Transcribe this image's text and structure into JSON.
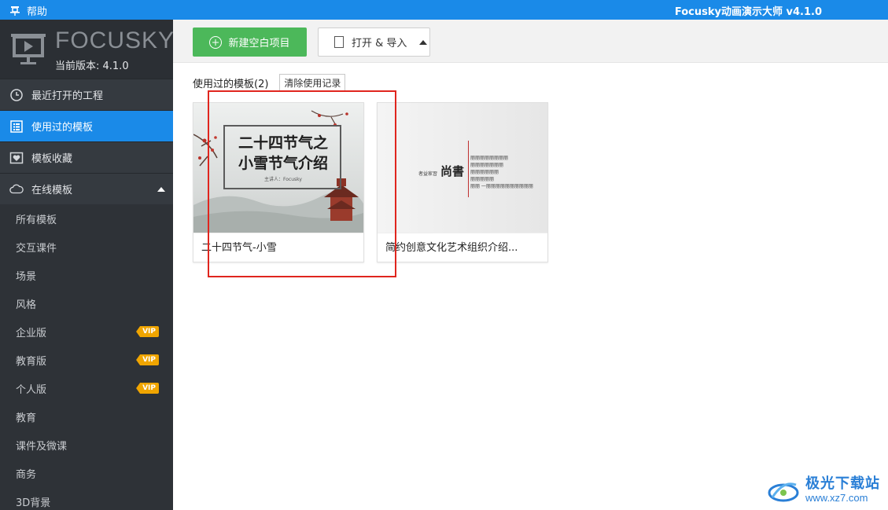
{
  "window": {
    "help_label": "帮助",
    "title": "Focusky动画演示大师 v4.1.0"
  },
  "brand": {
    "name": "FOCUSKY",
    "version": "当前版本: 4.1.0"
  },
  "nav": {
    "items": [
      {
        "label": "最近打开的工程",
        "icon": "clock-icon",
        "active": false
      },
      {
        "label": "使用过的模板",
        "icon": "list-icon",
        "active": true
      },
      {
        "label": "模板收藏",
        "icon": "heart-icon",
        "active": false
      },
      {
        "label": "在线模板",
        "icon": "cloud-icon",
        "active": false
      }
    ],
    "sub_items": [
      {
        "label": "所有模板",
        "badge": ""
      },
      {
        "label": "交互课件",
        "badge": ""
      },
      {
        "label": "场景",
        "badge": ""
      },
      {
        "label": "风格",
        "badge": ""
      },
      {
        "label": "企业版",
        "badge": "VIP"
      },
      {
        "label": "教育版",
        "badge": "VIP"
      },
      {
        "label": "个人版",
        "badge": "VIP"
      },
      {
        "label": "教育",
        "badge": ""
      },
      {
        "label": "课件及微课",
        "badge": ""
      },
      {
        "label": "商务",
        "badge": ""
      },
      {
        "label": "3D背景",
        "badge": ""
      }
    ]
  },
  "toolbar": {
    "new_label": "新建空白项目",
    "open_label": "打开 & 导入"
  },
  "section": {
    "title": "使用过的模板(2)",
    "clear_label": "清除使用记录"
  },
  "cards": [
    {
      "label": "二十四节气-小雪",
      "thumb_title_line1": "二十四节气之",
      "thumb_title_line2": "小雪节气介绍",
      "thumb_sub": "主讲人：Focusky"
    },
    {
      "label": "简约创意文化艺术组织介绍...",
      "thumb_main": "尚書",
      "thumb_pre": "者益家習",
      "thumb_lines": [
        "丽丽丽丽丽丽丽丽",
        "丽丽丽丽丽丽丽",
        "丽丽丽丽丽丽",
        "丽丽丽丽丽",
        "丽丽 一丽丽丽丽丽丽丽丽丽丽"
      ]
    }
  ],
  "watermark": {
    "cn": "极光下载站",
    "url": "www.xz7.com"
  },
  "colors": {
    "accent": "#1a8ae8",
    "sidebar": "#2e3237",
    "new_button": "#4cb85a",
    "vip": "#f0a500",
    "highlight": "#e0251e"
  }
}
